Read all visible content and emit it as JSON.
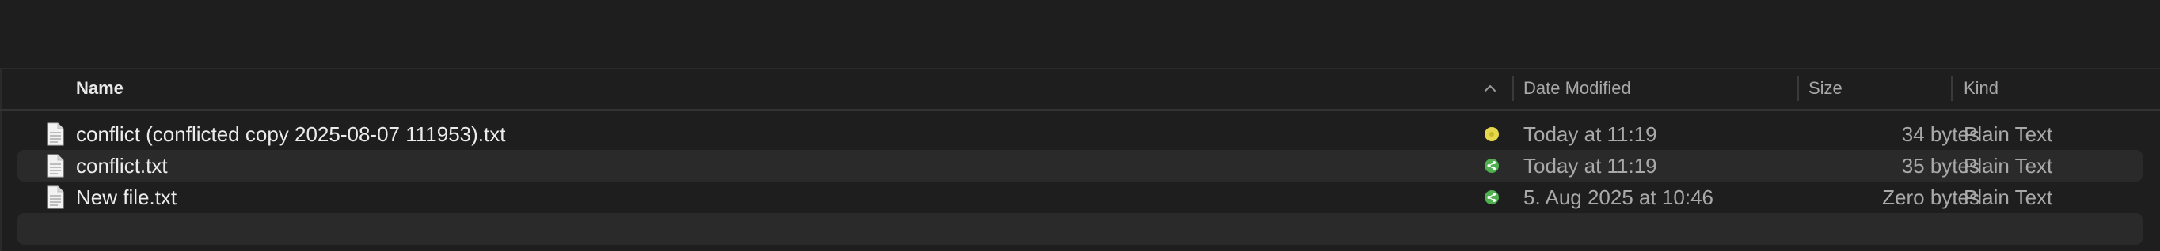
{
  "columns": {
    "name": "Name",
    "date_modified": "Date Modified",
    "size": "Size",
    "kind": "Kind"
  },
  "sort": {
    "column": "name",
    "direction": "ascending",
    "icon": "chevron-up-icon"
  },
  "files": [
    {
      "name": "conflict (conflicted copy 2025-08-07 111953).txt",
      "status": "conflict-yellow-dot",
      "status_color": "#e8d94a",
      "date_modified": "Today at 11:19",
      "size": "34 bytes",
      "kind": "Plain Text"
    },
    {
      "name": "conflict.txt",
      "status": "shared-green-icon",
      "status_color": "#5cb85c",
      "date_modified": "Today at 11:19",
      "size": "35 bytes",
      "kind": "Plain Text"
    },
    {
      "name": "New file.txt",
      "status": "shared-green-icon",
      "status_color": "#5cb85c",
      "date_modified": "5. Aug 2025 at 10:46",
      "size": "Zero bytes",
      "kind": "Plain Text"
    }
  ]
}
